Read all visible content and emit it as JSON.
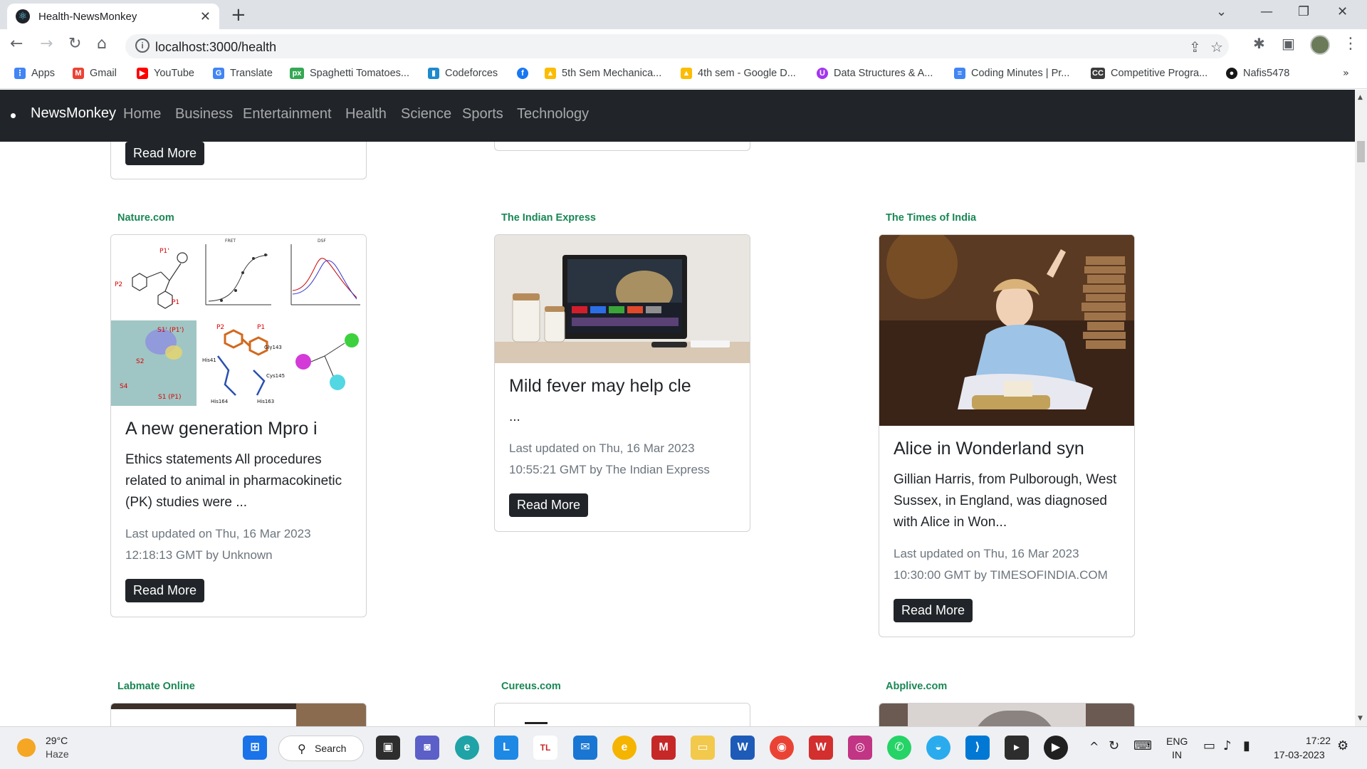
{
  "browser": {
    "tab_title": "Health-NewsMonkey",
    "url": "localhost:3000/health",
    "bookmarks": [
      {
        "label": "Apps",
        "icon": "apps-grid-icon",
        "color": "#4285f4"
      },
      {
        "label": "Gmail",
        "icon": "gmail-icon",
        "color": "#ea4335"
      },
      {
        "label": "YouTube",
        "icon": "youtube-icon",
        "color": "#ff0000"
      },
      {
        "label": "Translate",
        "icon": "translate-icon",
        "color": "#4285f4"
      },
      {
        "label": "Spaghetti Tomatoes...",
        "icon": "px-icon",
        "color": "#34a853"
      },
      {
        "label": "Codeforces",
        "icon": "codeforces-icon",
        "color": "#1f8acb"
      },
      {
        "label": "",
        "icon": "facebook-icon",
        "color": "#1877f2"
      },
      {
        "label": "5th Sem Mechanica...",
        "icon": "google-drive-icon",
        "color": "#fbbc04"
      },
      {
        "label": "4th sem - Google D...",
        "icon": "google-drive-icon",
        "color": "#fbbc04"
      },
      {
        "label": "Data Structures & A...",
        "icon": "udemy-icon",
        "color": "#a435f0"
      },
      {
        "label": "Coding Minutes | Pr...",
        "icon": "docs-icon",
        "color": "#4285f4"
      },
      {
        "label": "Competitive Progra...",
        "icon": "cc-icon",
        "color": "#3c3c3c"
      },
      {
        "label": "Nafis5478",
        "icon": "github-icon",
        "color": "#181717"
      }
    ]
  },
  "navbar": {
    "brand": "NewsMonkey",
    "links": [
      "Home",
      "Business",
      "Entertainment",
      "Health",
      "Science",
      "Sports",
      "Technology"
    ]
  },
  "partial_top": {
    "read_more": "Read More"
  },
  "cards": [
    {
      "source": "Nature.com",
      "title": "A new generation Mpro i",
      "description": "Ethics statements All procedures related to animal in pharmacokinetic (PK) studies were ...",
      "meta_line1": "Last updated on Thu, 16 Mar 2023",
      "meta_line2": "12:18:13 GMT by Unknown",
      "button": "Read More"
    },
    {
      "source": "The Indian Express",
      "title": "Mild fever may help cle",
      "description": "...",
      "meta_line1": "Last updated on Thu, 16 Mar 2023",
      "meta_line2": "10:55:21 GMT by The Indian Express",
      "button": "Read More"
    },
    {
      "source": "The Times of India",
      "title": "Alice in Wonderland syn",
      "description": "Gillian Harris, from Pulborough, West Sussex, in England, was diagnosed with Alice in Won...",
      "meta_line1": "Last updated on Thu, 16 Mar 2023",
      "meta_line2": "10:30:00 GMT by TIMESOFINDIA.COM",
      "button": "Read More"
    }
  ],
  "next_sources": [
    "Labmate Online",
    "Cureus.com",
    "Abplive.com"
  ],
  "taskbar": {
    "weather_temp": "29°C",
    "weather_desc": "Haze",
    "search_label": "Search",
    "lang_line1": "ENG",
    "lang_line2": "IN",
    "time": "17:22",
    "date": "17-03-2023"
  },
  "colors": {
    "navbar_bg": "#212529",
    "source_green": "#198754",
    "button_bg": "#212529"
  }
}
